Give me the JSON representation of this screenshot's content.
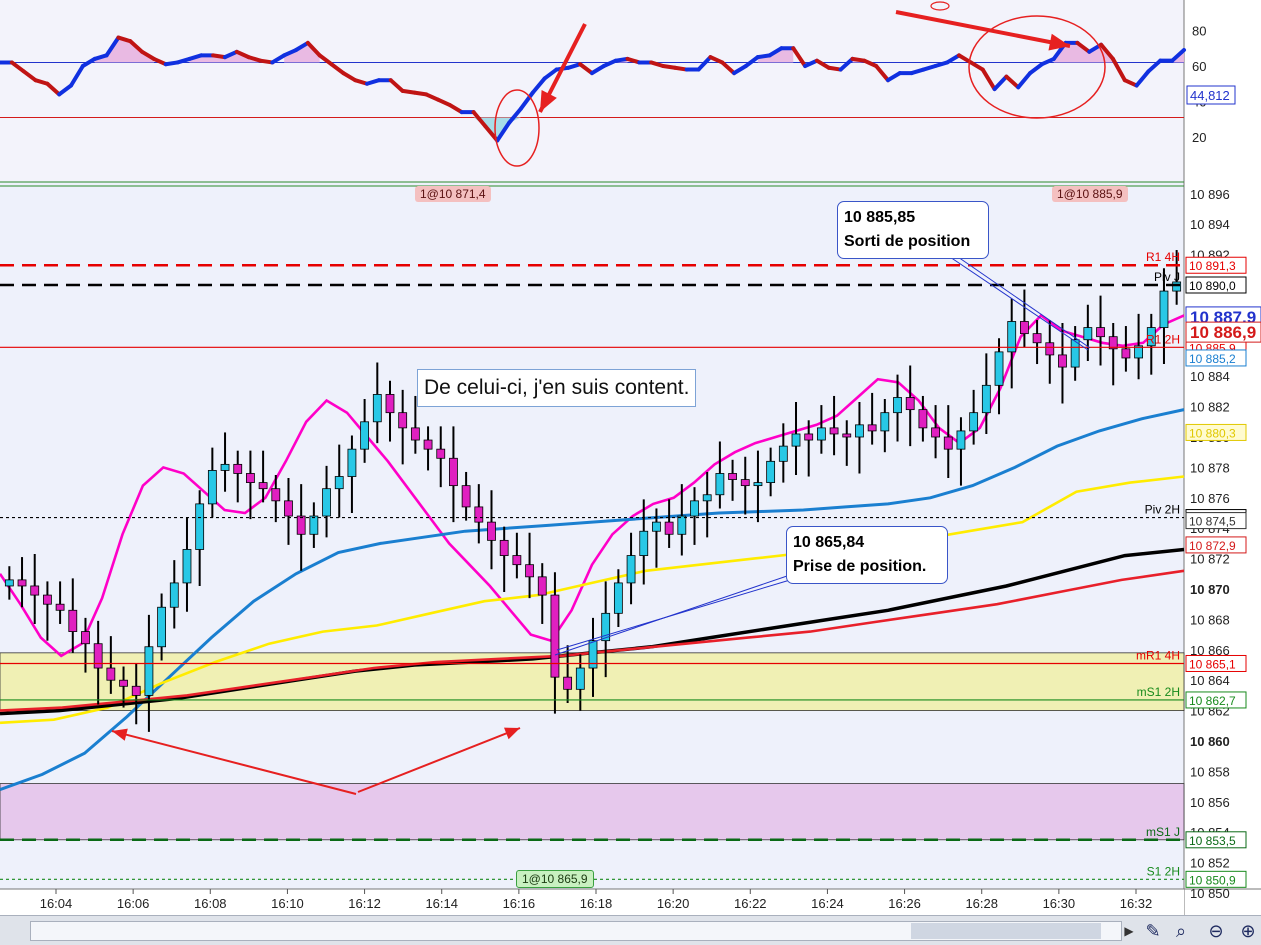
{
  "chart_data": [
    {
      "type": "line",
      "panel": "oscillator",
      "y_ticks": [
        "80",
        "60",
        "40",
        "20"
      ],
      "ylim": [
        10,
        90
      ],
      "current_value": "44,812",
      "levels": [
        62,
        31
      ],
      "series": [
        {
          "values": [
            62,
            62,
            57,
            52,
            50,
            44,
            49,
            60,
            64,
            66,
            76,
            74,
            68,
            64,
            61,
            62,
            64,
            66,
            66,
            65,
            68,
            65,
            63,
            62,
            66,
            69,
            73,
            66,
            61,
            56,
            52,
            50,
            52,
            52,
            46,
            45,
            44,
            41,
            38,
            34,
            34,
            26,
            18,
            28,
            36,
            45,
            53,
            58,
            59,
            61,
            56,
            60,
            63,
            64,
            62,
            62,
            60,
            59,
            58,
            58,
            65,
            62,
            56,
            60,
            65,
            66,
            70,
            70,
            60,
            63,
            59,
            58,
            64,
            63,
            60,
            52,
            56,
            56,
            58,
            60,
            62,
            66,
            62,
            58,
            47,
            54,
            48,
            56,
            61,
            64,
            73,
            73,
            68,
            72,
            64,
            52,
            49,
            57,
            63,
            63,
            69
          ]
        }
      ]
    },
    {
      "type": "candlestick",
      "panel": "price",
      "x_ticks": [
        "16:04",
        "16:06",
        "16:08",
        "16:10",
        "16:12",
        "16:14",
        "16:16",
        "16:18",
        "16:20",
        "16:22",
        "16:24",
        "16:26",
        "16:28",
        "16:30",
        "16:32"
      ],
      "y_ticks": [
        "10 896",
        "10 894",
        "10 892",
        "10 890",
        "10 888",
        "10 886",
        "10 884",
        "10 882",
        "10 880",
        "10 878",
        "10 876",
        "10 874",
        "10 872",
        "10 870",
        "10 868",
        "10 866",
        "10 864",
        "10 862",
        "10 860",
        "10 858",
        "10 856",
        "10 854",
        "10 852",
        "10 850"
      ],
      "ylim": [
        10849,
        10897
      ],
      "closes": [
        10870.6,
        10870.2,
        10869.6,
        10869.0,
        10868.6,
        10867.2,
        10866.4,
        10864.8,
        10864.0,
        10863.6,
        10863.0,
        10866.2,
        10868.8,
        10870.4,
        10872.6,
        10875.6,
        10877.8,
        10878.2,
        10877.6,
        10877.0,
        10876.6,
        10875.8,
        10874.8,
        10873.6,
        10874.8,
        10876.6,
        10877.4,
        10879.2,
        10881.0,
        10882.8,
        10881.6,
        10880.6,
        10879.8,
        10879.2,
        10878.6,
        10876.8,
        10875.4,
        10874.4,
        10873.2,
        10872.2,
        10871.6,
        10870.8,
        10869.6,
        10864.2,
        10863.4,
        10864.8,
        10866.6,
        10868.4,
        10870.4,
        10872.2,
        10873.8,
        10874.4,
        10873.6,
        10874.8,
        10875.8,
        10876.2,
        10877.6,
        10877.2,
        10876.8,
        10877.0,
        10878.4,
        10879.4,
        10880.2,
        10879.8,
        10880.6,
        10880.2,
        10880.0,
        10880.8,
        10880.4,
        10881.6,
        10882.6,
        10881.8,
        10880.6,
        10880.0,
        10879.2,
        10880.4,
        10881.6,
        10883.4,
        10885.6,
        10887.6,
        10886.8,
        10886.2,
        10885.4,
        10884.6,
        10886.4,
        10887.2,
        10886.6,
        10885.8,
        10885.2,
        10886.0,
        10887.2,
        10889.6,
        10890.2
      ],
      "moving_averages": [
        {
          "color": "#ff00c8",
          "values": [
            10871,
            10869,
            10866.8,
            10865.6,
            10866.4,
            10869.4,
            10873.6,
            10876.8,
            10878.0,
            10877.6,
            10876.4,
            10875.2,
            10875.0,
            10876.0,
            10878.4,
            10881.0,
            10882.4,
            10881.6,
            10880.0,
            10878.4,
            10876.6,
            10874.8,
            10873.0,
            10871.6,
            10870.2,
            10868.6,
            10867.0,
            10866.6,
            10868.6,
            10871.6,
            10873.6,
            10874.8,
            10875.6,
            10876.0,
            10877.0,
            10878.2,
            10879.0,
            10879.6,
            10880.0,
            10880.4,
            10880.8,
            10881.4,
            10882.6,
            10883.8,
            10883.6,
            10882.4,
            10880.6,
            10879.6,
            10880.6,
            10883.2,
            10886.6,
            10888.0,
            10887.0,
            10886.6,
            10886.2,
            10886.0,
            10886.2,
            10887.4,
            10888.0
          ]
        },
        {
          "color": "#1a7fd0",
          "values": [
            10856.8,
            10857.8,
            10859.2,
            10861.6,
            10864.2,
            10866.8,
            10869.2,
            10871.0,
            10872.4,
            10873.0,
            10873.4,
            10873.8,
            10874.0,
            10874.2,
            10874.4,
            10874.6,
            10874.8,
            10875.0,
            10875.1,
            10875.2,
            10875.4,
            10875.6,
            10876.0,
            10876.8,
            10878.0,
            10879.4,
            10880.4,
            10881.2,
            10881.8
          ]
        },
        {
          "color": "#ffec00",
          "values": [
            10861.2,
            10861.4,
            10862.2,
            10863.8,
            10865.2,
            10866.4,
            10867.2,
            10867.6,
            10868.4,
            10869.2,
            10869.6,
            10870.4,
            10871.2,
            10871.6,
            10872.0,
            10872.4,
            10872.6,
            10873.2,
            10873.8,
            10874.4,
            10876.4,
            10877.0,
            10877.4
          ]
        },
        {
          "color": "#000000",
          "values": [
            10861.8,
            10862.0,
            10862.4,
            10862.8,
            10863.4,
            10864.0,
            10864.6,
            10865.0,
            10865.2,
            10865.4,
            10865.8,
            10866.2,
            10866.8,
            10867.4,
            10868.0,
            10868.6,
            10869.4,
            10870.2,
            10871.2,
            10872.2,
            10872.6
          ]
        },
        {
          "color": "#e8202a",
          "values": [
            10862.0,
            10862.2,
            10862.6,
            10863.0,
            10863.6,
            10864.2,
            10864.8,
            10865.2,
            10865.4,
            10865.6,
            10866.0,
            10866.4,
            10866.8,
            10867.2,
            10867.8,
            10868.4,
            10869.0,
            10869.8,
            10870.6,
            10871.2
          ]
        }
      ],
      "levels": [
        {
          "name": "R1 4H",
          "value": "10 891,3",
          "color": "#e60000",
          "style": "dashed"
        },
        {
          "name": "Piv J",
          "value": "10 890,0",
          "color": "#000000",
          "style": "dashed"
        },
        {
          "name": "mS1 J",
          "value": "10 853,5",
          "color": "#0a6a16",
          "style": "dashed"
        },
        {
          "name": "Piv 2H",
          "value": "10 874,7",
          "color": "#000000",
          "style": "dotted"
        },
        {
          "name": "R1 2H",
          "value": "10 885,9",
          "color": "#e60000",
          "style": "solid"
        },
        {
          "name": "mR1 4H",
          "value": "10 865,1",
          "color": "#e60000",
          "style": "solid"
        },
        {
          "name": "mS1 2H",
          "value": "10 862,7",
          "color": "#178a1c",
          "style": "solid"
        },
        {
          "name": "S1 2H",
          "value": "10 850,9",
          "color": "#178a1c",
          "style": "dotted"
        }
      ],
      "zones": [
        {
          "from": 10862.0,
          "to": 10865.8,
          "color": "#f0f0b4"
        },
        {
          "from": 10853.5,
          "to": 10857.2,
          "color": "#e6c8ec"
        }
      ],
      "axis_tags": {
        "indicator_value_1": "10 880,3",
        "indicator_value_2": "10 874,5",
        "indicator_value_3": "10 872,9",
        "indicator_value_4": "10 885,2",
        "current_price": "10 887,9",
        "position_price": "10 886,9"
      }
    }
  ],
  "annotations": {
    "exit_note": {
      "price": "10 885,85",
      "text": "Sorti de position"
    },
    "entry_note": {
      "price": "10 865,84",
      "text": "Prise de position."
    },
    "comment": "De celui-ci, j'en suis content.",
    "fill_top_left": "1@10 871,4",
    "fill_top_right": "1@10 885,9",
    "fill_bottom": "1@10 865,9"
  },
  "colors": {
    "bull_candle": "#28c8e6",
    "bear_candle": "#e020c0",
    "osc_up": "#1030e0",
    "osc_down": "#c01414",
    "arrow": "#e62020"
  }
}
